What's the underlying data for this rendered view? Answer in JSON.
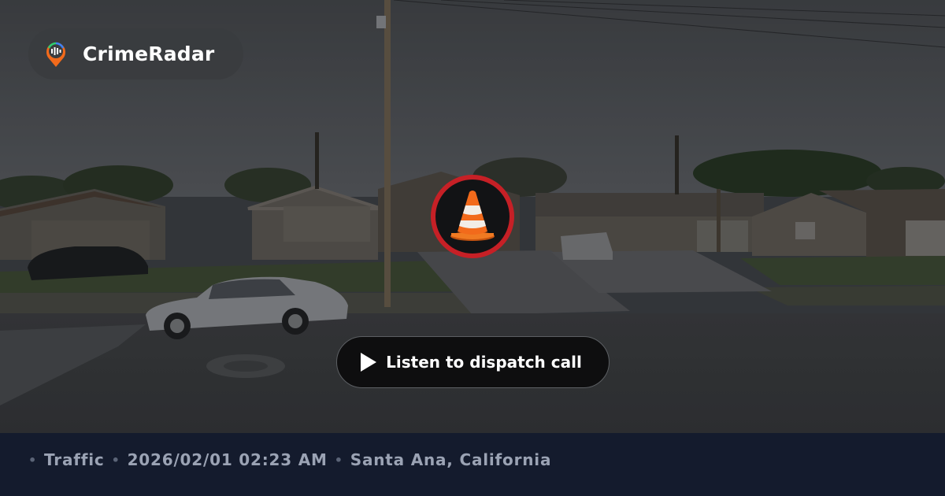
{
  "brand": {
    "name": "CrimeRadar",
    "logo_icon": "radar-pin-icon"
  },
  "incident": {
    "icon": "traffic-cone-icon",
    "badge_color": "#c62026"
  },
  "cta": {
    "label": "Listen to dispatch call",
    "icon": "play-icon"
  },
  "footer": {
    "separator": "•",
    "category": "Traffic",
    "datetime": "2026/02/01 02:23 AM",
    "location": "Santa Ana, California"
  },
  "colors": {
    "footer_bg": "#141b2d",
    "footer_text": "#9ba3b4",
    "accent_orange": "#f26a1b"
  }
}
